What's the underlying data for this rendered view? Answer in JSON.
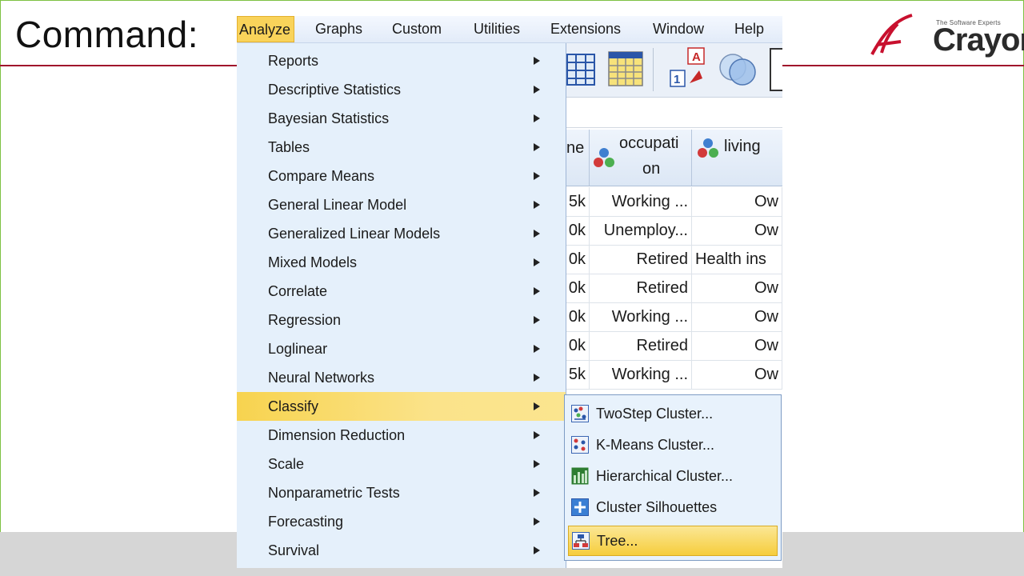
{
  "slide": {
    "title": "Command:",
    "logo": {
      "tagline": "The Software Experts",
      "wordmark": "Crayon"
    }
  },
  "menubar": {
    "items": [
      {
        "label": "Analyze",
        "active": true
      },
      {
        "label": "Graphs"
      },
      {
        "label": "Custom"
      },
      {
        "label": "Utilities"
      },
      {
        "label": "Extensions"
      },
      {
        "label": "Window"
      },
      {
        "label": "Help"
      }
    ]
  },
  "analyze_menu": {
    "items": [
      {
        "label": "Reports"
      },
      {
        "label": "Descriptive Statistics"
      },
      {
        "label": "Bayesian Statistics"
      },
      {
        "label": "Tables"
      },
      {
        "label": "Compare Means"
      },
      {
        "label": "General Linear Model"
      },
      {
        "label": "Generalized Linear Models"
      },
      {
        "label": "Mixed Models"
      },
      {
        "label": "Correlate"
      },
      {
        "label": "Regression"
      },
      {
        "label": "Loglinear"
      },
      {
        "label": "Neural Networks"
      },
      {
        "label": "Classify",
        "active": true
      },
      {
        "label": "Dimension Reduction"
      },
      {
        "label": "Scale"
      },
      {
        "label": "Nonparametric Tests"
      },
      {
        "label": "Forecasting"
      },
      {
        "label": "Survival"
      }
    ]
  },
  "classify_submenu": {
    "items": [
      {
        "label": "TwoStep Cluster...",
        "icon": "twostep-cluster-icon"
      },
      {
        "label": "K-Means Cluster...",
        "icon": "kmeans-cluster-icon"
      },
      {
        "label": "Hierarchical Cluster...",
        "icon": "hierarchical-cluster-icon"
      },
      {
        "label": "Cluster Silhouettes",
        "icon": "cluster-silhouettes-icon"
      },
      {
        "label": "Tree...",
        "icon": "tree-icon",
        "active": true
      }
    ]
  },
  "data_grid": {
    "columns": [
      {
        "label": "ne"
      },
      {
        "label_line1": "occupati",
        "label_line2": "on"
      },
      {
        "label": "living"
      }
    ],
    "rows": [
      [
        "5k",
        "Working ...",
        "Ow"
      ],
      [
        "0k",
        "Unemploy...",
        "Ow"
      ],
      [
        "0k",
        "Retired",
        "Health ins"
      ],
      [
        "0k",
        "Retired",
        "Ow"
      ],
      [
        "0k",
        "Working ...",
        "Ow"
      ],
      [
        "0k",
        "Retired",
        "Ow"
      ],
      [
        "5k",
        "Working ...",
        "Ow"
      ]
    ]
  },
  "colors": {
    "accent": "#a0152c",
    "menu_bg": "#e5f0fb",
    "highlight": "#f7d34f",
    "frame": "#7dc242"
  }
}
